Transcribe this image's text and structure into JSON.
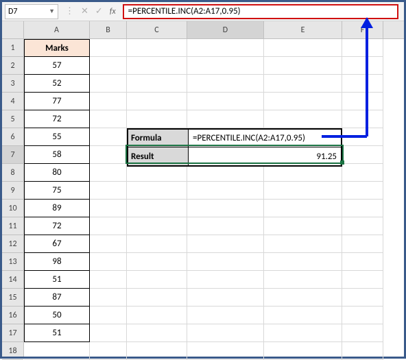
{
  "namebox": "D7",
  "formula_bar": "=PERCENTILE.INC(A2:A17,0.95)",
  "columns": {
    "A": "A",
    "B": "B",
    "C": "C",
    "D": "D",
    "E": "E",
    "F": "F"
  },
  "rows": [
    "1",
    "2",
    "3",
    "4",
    "5",
    "6",
    "7",
    "8",
    "9",
    "10",
    "11",
    "12",
    "13",
    "14",
    "15",
    "16",
    "17",
    "18"
  ],
  "col_A_header": "Marks",
  "col_A": [
    "57",
    "52",
    "77",
    "72",
    "55",
    "58",
    "80",
    "75",
    "89",
    "72",
    "67",
    "98",
    "51",
    "87",
    "50",
    "51"
  ],
  "box": {
    "formula_label": "Formula",
    "formula_value": "=PERCENTILE.INC(A2:A17,0.95)",
    "result_label": "Result",
    "result_value": "91.25"
  },
  "chart_data": {
    "type": "table",
    "title": "Marks",
    "categories": [
      "A2",
      "A3",
      "A4",
      "A5",
      "A6",
      "A7",
      "A8",
      "A9",
      "A10",
      "A11",
      "A12",
      "A13",
      "A14",
      "A15",
      "A16",
      "A17"
    ],
    "values": [
      57,
      52,
      77,
      72,
      55,
      58,
      80,
      75,
      89,
      72,
      67,
      98,
      51,
      87,
      50,
      51
    ],
    "derived": {
      "function": "PERCENTILE.INC",
      "k": 0.95,
      "result": 91.25
    }
  }
}
